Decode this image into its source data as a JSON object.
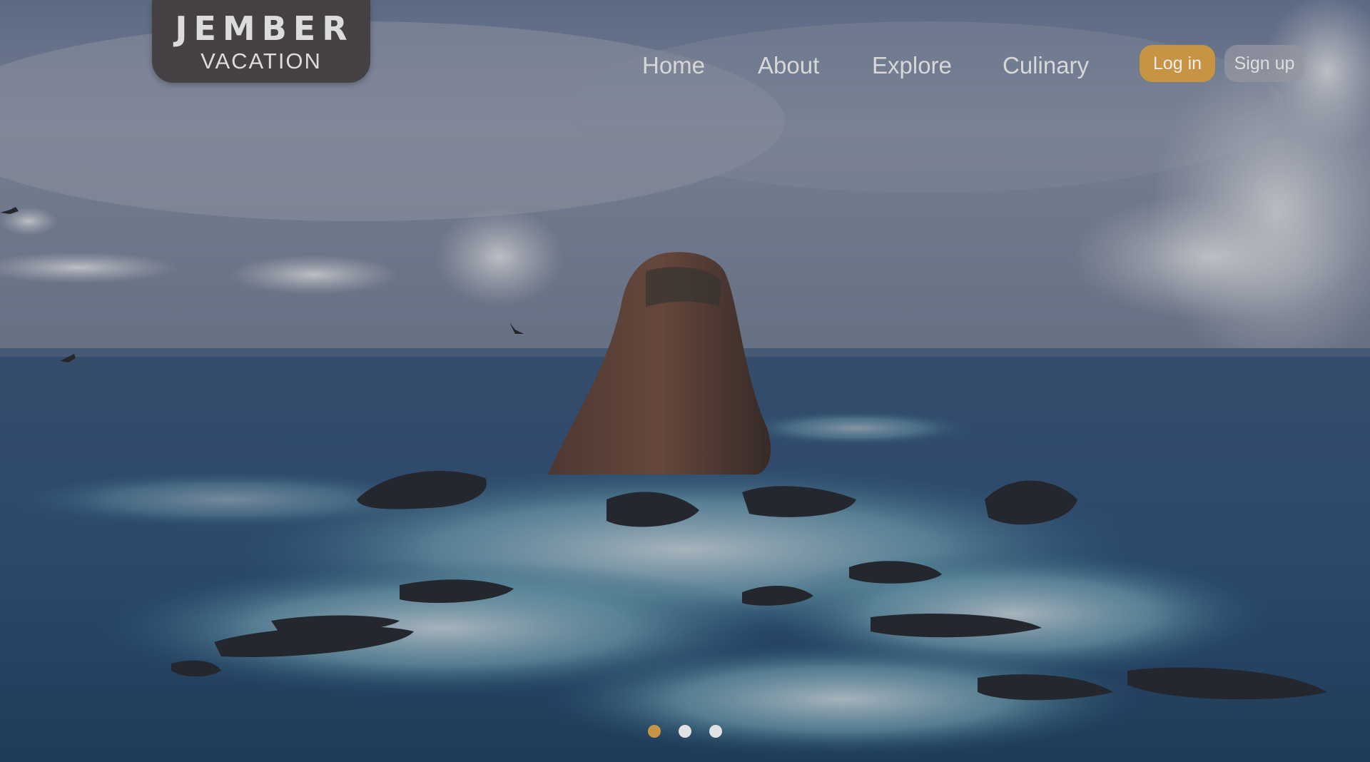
{
  "logo": {
    "line1": "JEMBER",
    "line2": "VACATION"
  },
  "nav": {
    "items": [
      {
        "label": "Home"
      },
      {
        "label": "About"
      },
      {
        "label": "Explore"
      },
      {
        "label": "Culinary"
      }
    ]
  },
  "auth": {
    "login_label": "Log in",
    "signup_label": "Sign up"
  },
  "carousel": {
    "slide_count": 3,
    "active_index": 0
  },
  "colors": {
    "accent": "#c69443",
    "logo_bg": "#443e42"
  }
}
